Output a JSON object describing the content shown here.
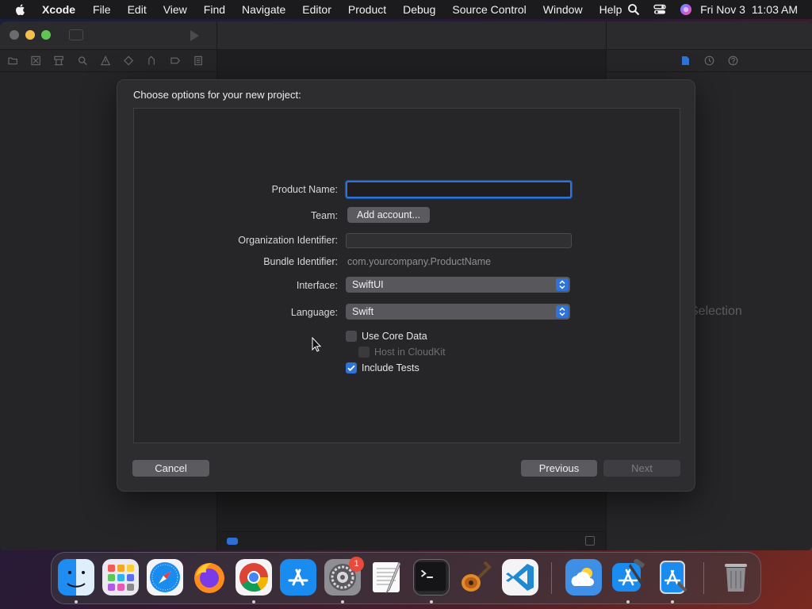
{
  "menubar": {
    "app_name": "Xcode",
    "items": [
      "File",
      "Edit",
      "View",
      "Find",
      "Navigate",
      "Editor",
      "Product",
      "Debug",
      "Source Control",
      "Window",
      "Help"
    ],
    "clock_date": "Fri Nov 3",
    "clock_time": "11:03 AM"
  },
  "xcode": {
    "no_selection": "Selection",
    "accent": "#2f73d8"
  },
  "dialog": {
    "heading": "Choose options for your new project:",
    "labels": {
      "product_name": "Product Name:",
      "team": "Team:",
      "org_id": "Organization Identifier:",
      "bundle_id": "Bundle Identifier:",
      "interface": "Interface:",
      "language": "Language:"
    },
    "product_name_value": "",
    "team_button": "Add account...",
    "org_id_value": "",
    "bundle_id_value": "com.yourcompany.ProductName",
    "interface_value": "SwiftUI",
    "language_value": "Swift",
    "checkboxes": {
      "use_core_data": {
        "label": "Use Core Data",
        "checked": false
      },
      "host_in_cloudkit": {
        "label": "Host in CloudKit",
        "checked": false,
        "disabled": true
      },
      "include_tests": {
        "label": "Include Tests",
        "checked": true
      }
    },
    "buttons": {
      "cancel": "Cancel",
      "previous": "Previous",
      "next": "Next"
    }
  },
  "dock": {
    "apps": [
      "finder-icon",
      "launchpad-icon",
      "safari-icon",
      "firefox-icon",
      "chrome-icon",
      "app-store-icon",
      "system-settings-icon",
      "textedit-icon",
      "terminal-icon",
      "garageband-icon",
      "vscode-icon",
      "weather-icon",
      "xcode-icon",
      "simulator-icon",
      "trash-icon"
    ],
    "settings_badge": "1"
  }
}
